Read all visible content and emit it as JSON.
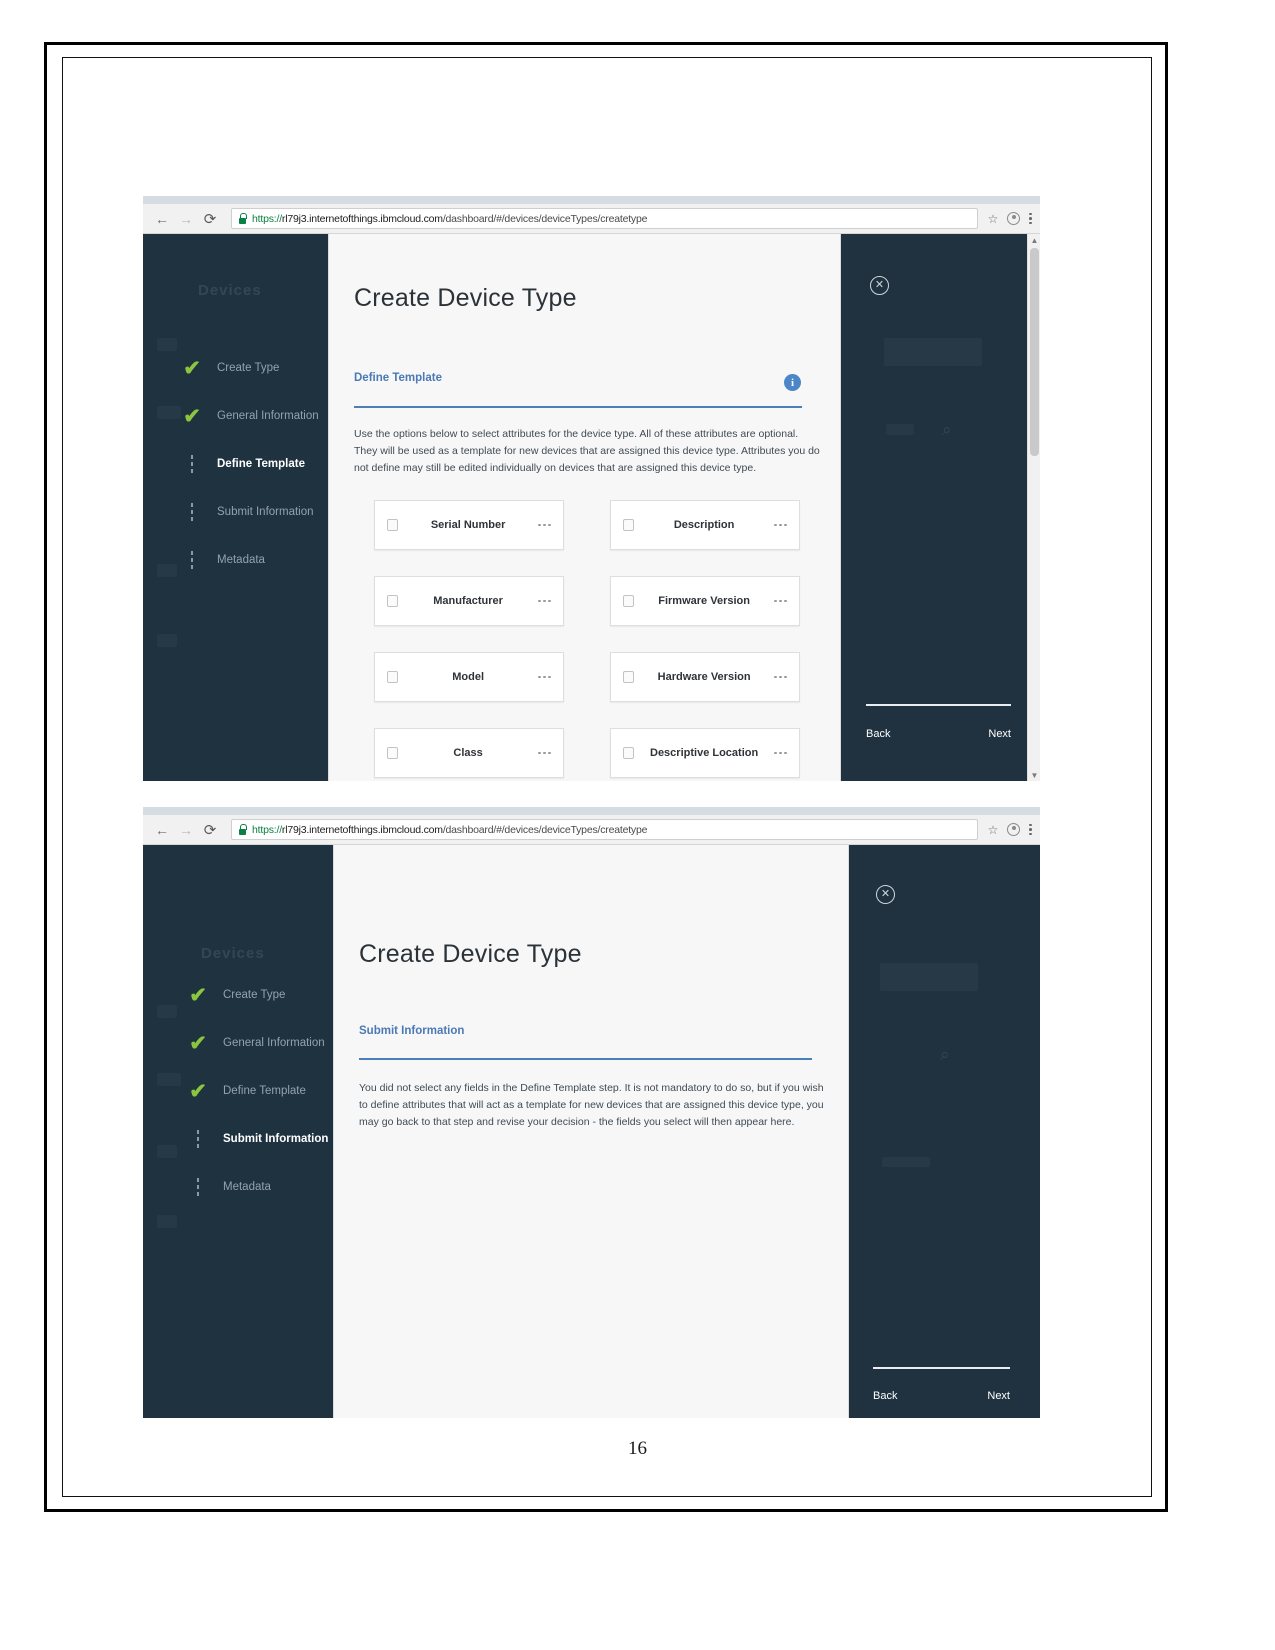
{
  "document": {
    "page_number": "16"
  },
  "browser": {
    "back_icon": "←",
    "forward_icon": "→",
    "reload_icon": "⟳",
    "lock_icon": "lock-icon",
    "url_scheme": "https://",
    "url_host": "rl79j3.internetofthings.ibmcloud.com",
    "url_path": "/dashboard/#/devices/deviceTypes/createtype",
    "star_icon": "☆",
    "profile_icon": "avatar-icon",
    "menu_icon": "kebab-icon"
  },
  "screenshot_top": {
    "modal_title": "Create Device Type",
    "section_label": "Define Template",
    "info_icon": "i",
    "body_text": "Use the options below to select attributes for the device type. All of these attributes are optional. They will be used as a template for new devices that are assigned this device type. Attributes you do not define may still be edited individually on devices that are assigned this device type.",
    "steps": [
      {
        "label": "Create Type",
        "state": "complete"
      },
      {
        "label": "General Information",
        "state": "complete"
      },
      {
        "label": "Define Template",
        "state": "active"
      },
      {
        "label": "Submit Information",
        "state": "pending"
      },
      {
        "label": "Metadata",
        "state": "pending"
      }
    ],
    "attributes": [
      {
        "label": "Serial Number",
        "checked": false
      },
      {
        "label": "Description",
        "checked": false
      },
      {
        "label": "Manufacturer",
        "checked": false
      },
      {
        "label": "Firmware Version",
        "checked": false
      },
      {
        "label": "Model",
        "checked": false
      },
      {
        "label": "Hardware Version",
        "checked": false
      },
      {
        "label": "Class",
        "checked": false
      },
      {
        "label": "Descriptive Location",
        "checked": false
      }
    ],
    "close_icon": "✕",
    "back_label": "Back",
    "next_label": "Next",
    "ghost_nav_title": "Devices"
  },
  "screenshot_bottom": {
    "modal_title": "Create Device Type",
    "section_label": "Submit Information",
    "body_text": "You did not select any fields in the Define Template step. It is not mandatory to do so, but if you wish to define attributes that will act as a template for new devices that are assigned this device type, you may go back to that step and revise your decision - the fields you select will then appear here.",
    "steps": [
      {
        "label": "Create Type",
        "state": "complete"
      },
      {
        "label": "General Information",
        "state": "complete"
      },
      {
        "label": "Define Template",
        "state": "complete"
      },
      {
        "label": "Submit Information",
        "state": "active"
      },
      {
        "label": "Metadata",
        "state": "pending"
      }
    ],
    "close_icon": "✕",
    "back_label": "Back",
    "next_label": "Next",
    "ghost_nav_title": "Devices"
  },
  "colors": {
    "app_navy": "#203240",
    "accent_blue": "#4a7fb8",
    "check_green": "#8cc63f",
    "modal_bg": "#f7f7f7"
  }
}
